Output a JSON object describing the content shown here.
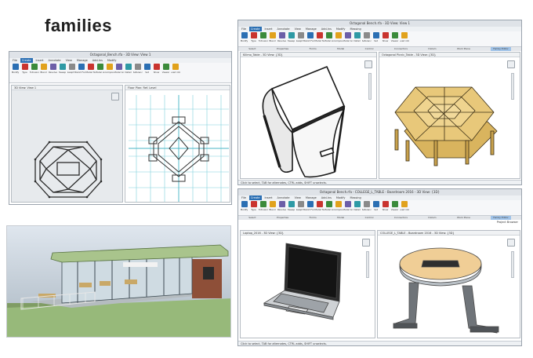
{
  "heading": "families",
  "window_tl": {
    "title": "Octagonal_Bench.rfa - 3D View: View 1",
    "tabs": [
      "File",
      "Create",
      "Insert",
      "Annotate",
      "View",
      "Manage",
      "Add-Ins",
      "Modify"
    ],
    "active_tab": "Create",
    "left_pane_title": "3D View: View 1",
    "right_pane_title": "Floor Plan: Ref. Level"
  },
  "window_tr": {
    "title": "Octagonal Bench.rfa - 3D View: View 1",
    "tabs": [
      "File",
      "Create",
      "Insert",
      "Annotate",
      "View",
      "Manage",
      "Add-Ins",
      "Modify",
      "Massing"
    ],
    "active_tab": "Create",
    "ribbon": [
      "Modify",
      "Type",
      "Extrusion",
      "Blend",
      "Revolve",
      "Sweep",
      "Swept Blend",
      "Void Forms",
      "Model Text",
      "Model Line",
      "Component",
      "Model Group",
      "Detail",
      "Reference Plane",
      "Set",
      "Show",
      "Viewer",
      "Load into Project"
    ],
    "groups": [
      "Select",
      "Properties",
      "Forms",
      "Model",
      "Control",
      "Connectors",
      "Datum",
      "Work Plane",
      "Family Editor"
    ],
    "left_pane_title": "Kilimo_Table - 3D View: {3D}",
    "right_pane_title": "Octagonal Picnic_Table - 3D View: {3D}",
    "status": "Click to select, TAB for alternates, CTRL adds, SHIFT unselects."
  },
  "window_br": {
    "title": "Octagonal Bench.rfa - COLLEGE_L_TABLE - Boardroom 2016 - 3D View: {3D}",
    "tabs": [
      "File",
      "Create",
      "Insert",
      "Annotate",
      "View",
      "Manage",
      "Add-Ins",
      "Modify",
      "Massing"
    ],
    "active_tab": "Create",
    "ribbon": [
      "Modify",
      "Type",
      "Extrusion",
      "Blend",
      "Revolve",
      "Sweep",
      "Swept Blend",
      "Void Forms",
      "Model Text",
      "Model Line",
      "Component",
      "Model Group",
      "Detail",
      "Reference Plane",
      "Set",
      "Show",
      "Viewer",
      "Load into Project"
    ],
    "groups": [
      "Select",
      "Properties",
      "Forms",
      "Model",
      "Control",
      "Connectors",
      "Datum",
      "Work Plane",
      "Family Editor"
    ],
    "left_pane_title": "Laptop_2016 - 3D View: {3D}",
    "right_pane_title": "COLLEGE_L_TABLE - Boardroom 2016 - 3D View: {3D}",
    "status": "Click to select, TAB for alternates, CTRL adds, SHIFT unselects.",
    "project_browser": "Project Browser"
  },
  "colors": {
    "accent": "#2b6fb3",
    "wood": "#e8c87a",
    "glass": "#b9c9d2",
    "roof": "#a9c48c",
    "sky": "#c9d6e2",
    "ground": "#96b878"
  }
}
